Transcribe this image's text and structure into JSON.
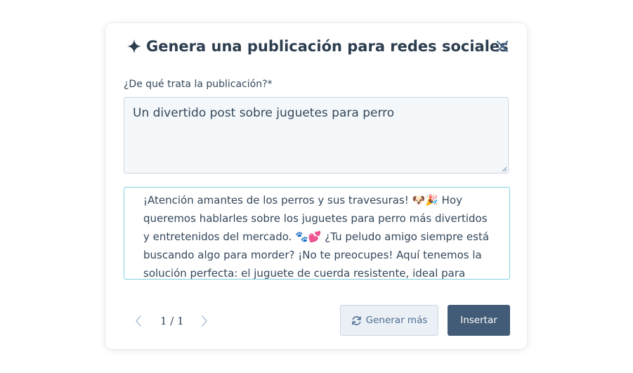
{
  "dialog": {
    "title": "Genera una publicación para redes sociales",
    "topic_label": "¿De qué trata la publicación?*",
    "topic_value": "Un divertido post sobre juguetes para perro",
    "result_text": "¡Atención amantes de los perros y sus travesuras! 🐶🎉 Hoy queremos hablarles sobre los juguetes para perro más divertidos y entretenidos del mercado. 🐾💕 ¿Tu peludo amigo siempre está buscando algo para morder? ¡No te preocupes! Aquí tenemos la solución perfecta: el juguete de cuerda resistente, ideal para esos",
    "pager": {
      "text": "1 / 1"
    },
    "buttons": {
      "generate_more": "Generar más",
      "insert": "Insertar"
    }
  },
  "colors": {
    "title": "#2d3e50",
    "text": "#33475b",
    "primary_button": "#425b76",
    "secondary_button_bg": "#eaf0f6",
    "result_border": "#7fd1de"
  },
  "icons": {
    "title_icon": "sparkle-icon",
    "close": "close-icon",
    "prev": "chevron-left-icon",
    "next": "chevron-right-icon",
    "generate_more": "refresh-icon"
  }
}
